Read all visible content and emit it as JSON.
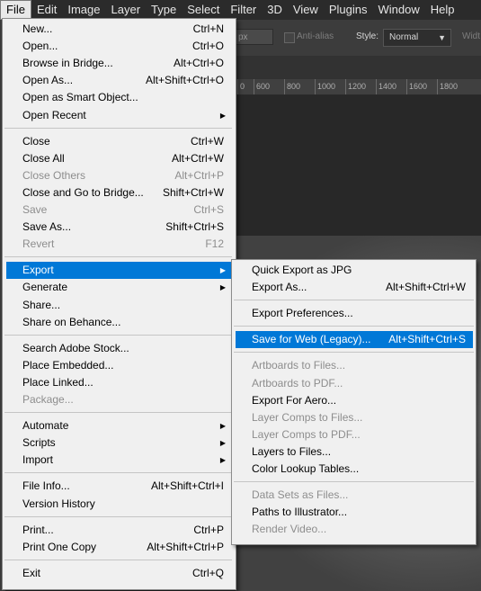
{
  "menubar": [
    "File",
    "Edit",
    "Image",
    "Layer",
    "Type",
    "Select",
    "Filter",
    "3D",
    "View",
    "Plugins",
    "Window",
    "Help"
  ],
  "options_bar": {
    "size_value": "px",
    "anti_alias_label": "Anti-alias",
    "style_label": "Style:",
    "style_value": "Normal",
    "width_label": "Widt"
  },
  "ruler_ticks": [
    "0",
    "600",
    "800",
    "1000",
    "1200",
    "1400",
    "1600",
    "1800"
  ],
  "file_menu": {
    "groups": [
      [
        {
          "label": "New...",
          "shortcut": "Ctrl+N"
        },
        {
          "label": "Open...",
          "shortcut": "Ctrl+O"
        },
        {
          "label": "Browse in Bridge...",
          "shortcut": "Alt+Ctrl+O"
        },
        {
          "label": "Open As...",
          "shortcut": "Alt+Shift+Ctrl+O"
        },
        {
          "label": "Open as Smart Object...",
          "shortcut": ""
        },
        {
          "label": "Open Recent",
          "shortcut": "",
          "submenu": true
        }
      ],
      [
        {
          "label": "Close",
          "shortcut": "Ctrl+W"
        },
        {
          "label": "Close All",
          "shortcut": "Alt+Ctrl+W"
        },
        {
          "label": "Close Others",
          "shortcut": "Alt+Ctrl+P",
          "disabled": true
        },
        {
          "label": "Close and Go to Bridge...",
          "shortcut": "Shift+Ctrl+W"
        },
        {
          "label": "Save",
          "shortcut": "Ctrl+S",
          "disabled": true
        },
        {
          "label": "Save As...",
          "shortcut": "Shift+Ctrl+S"
        },
        {
          "label": "Revert",
          "shortcut": "F12",
          "disabled": true
        }
      ],
      [
        {
          "label": "Export",
          "shortcut": "",
          "submenu": true,
          "highlighted": true
        },
        {
          "label": "Generate",
          "shortcut": "",
          "submenu": true
        },
        {
          "label": "Share...",
          "shortcut": ""
        },
        {
          "label": "Share on Behance...",
          "shortcut": ""
        }
      ],
      [
        {
          "label": "Search Adobe Stock...",
          "shortcut": ""
        },
        {
          "label": "Place Embedded...",
          "shortcut": ""
        },
        {
          "label": "Place Linked...",
          "shortcut": ""
        },
        {
          "label": "Package...",
          "shortcut": "",
          "disabled": true
        }
      ],
      [
        {
          "label": "Automate",
          "shortcut": "",
          "submenu": true
        },
        {
          "label": "Scripts",
          "shortcut": "",
          "submenu": true
        },
        {
          "label": "Import",
          "shortcut": "",
          "submenu": true
        }
      ],
      [
        {
          "label": "File Info...",
          "shortcut": "Alt+Shift+Ctrl+I"
        },
        {
          "label": "Version History",
          "shortcut": ""
        }
      ],
      [
        {
          "label": "Print...",
          "shortcut": "Ctrl+P"
        },
        {
          "label": "Print One Copy",
          "shortcut": "Alt+Shift+Ctrl+P"
        }
      ],
      [
        {
          "label": "Exit",
          "shortcut": "Ctrl+Q"
        }
      ]
    ]
  },
  "export_menu": {
    "groups": [
      [
        {
          "label": "Quick Export as JPG",
          "shortcut": ""
        },
        {
          "label": "Export As...",
          "shortcut": "Alt+Shift+Ctrl+W"
        }
      ],
      [
        {
          "label": "Export Preferences...",
          "shortcut": ""
        }
      ],
      [
        {
          "label": "Save for Web (Legacy)...",
          "shortcut": "Alt+Shift+Ctrl+S",
          "highlighted": true
        }
      ],
      [
        {
          "label": "Artboards to Files...",
          "shortcut": "",
          "disabled": true
        },
        {
          "label": "Artboards to PDF...",
          "shortcut": "",
          "disabled": true
        },
        {
          "label": "Export For Aero...",
          "shortcut": ""
        },
        {
          "label": "Layer Comps to Files...",
          "shortcut": "",
          "disabled": true
        },
        {
          "label": "Layer Comps to PDF...",
          "shortcut": "",
          "disabled": true
        },
        {
          "label": "Layers to Files...",
          "shortcut": ""
        },
        {
          "label": "Color Lookup Tables...",
          "shortcut": ""
        }
      ],
      [
        {
          "label": "Data Sets as Files...",
          "shortcut": "",
          "disabled": true
        },
        {
          "label": "Paths to Illustrator...",
          "shortcut": ""
        },
        {
          "label": "Render Video...",
          "shortcut": "",
          "disabled": true
        }
      ]
    ]
  },
  "colors": {
    "highlight": "#0078d7",
    "menu_bg": "#f0f0f0",
    "menubar_bg": "#2b2b2b"
  }
}
